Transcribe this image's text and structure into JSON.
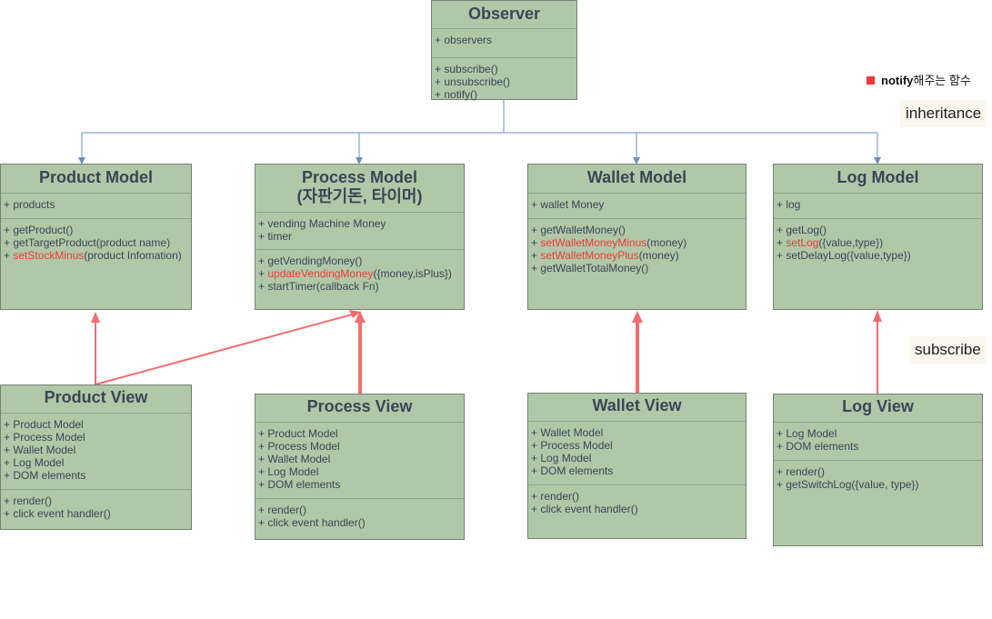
{
  "legend": {
    "bold": "notify",
    "rest": "해주는 함수"
  },
  "tags": {
    "inheritance": "inheritance",
    "subscribe": "subscribe"
  },
  "colors": {
    "box_fill": "#b0c8a8",
    "box_border": "#738272",
    "highlight": "#f0393b",
    "subscribe_arrow": "#f26d6d",
    "inherit_line": "#6c8ebf"
  },
  "observer": {
    "title": "Observer",
    "attrs": [
      "+ observers"
    ],
    "methods": [
      "+ subscribe()",
      "+ unsubscribe()",
      "+ notify()"
    ]
  },
  "product_model": {
    "title": "Product Model",
    "attrs": [
      "+ products"
    ],
    "methods": [
      {
        "pre": "+ ",
        "hl": "",
        "rest": "getProduct()"
      },
      {
        "pre": "+ ",
        "hl": "",
        "rest": "getTargetProduct(product name)"
      },
      {
        "pre": "+ ",
        "hl": "setStockMinus",
        "rest": "(product Infomation)"
      }
    ]
  },
  "process_model": {
    "title_line1": "Process Model",
    "title_line2": "(자판기돈, 타이머)",
    "attrs": [
      "+ vending Machine Money",
      "+ timer"
    ],
    "methods": [
      {
        "pre": "+ ",
        "hl": "",
        "rest": "getVendingMoney()"
      },
      {
        "pre": "+ ",
        "hl": "updateVendingMoney",
        "rest": "({money,isPlus})"
      },
      {
        "pre": "+ ",
        "hl": "",
        "rest": "startTimer(callback Fn)"
      }
    ]
  },
  "wallet_model": {
    "title": "Wallet Model",
    "attrs": [
      "+ wallet Money"
    ],
    "methods": [
      {
        "pre": "+ ",
        "hl": "",
        "rest": "getWalletMoney()"
      },
      {
        "pre": "+ ",
        "hl": "setWalletMoneyMinus",
        "rest": "(money)"
      },
      {
        "pre": "+ ",
        "hl": "setWalletMoneyPlus",
        "rest": "(money)"
      },
      {
        "pre": "+ ",
        "hl": "",
        "rest": "getWalletTotalMoney()"
      }
    ]
  },
  "log_model": {
    "title": "Log Model",
    "attrs": [
      "+ log"
    ],
    "methods": [
      {
        "pre": "+ ",
        "hl": "",
        "rest": "getLog()"
      },
      {
        "pre": "+ ",
        "hl": "setLog",
        "rest": "({value,type})"
      },
      {
        "pre": "+ ",
        "hl": "",
        "rest": "setDelayLog({value,type})"
      }
    ]
  },
  "product_view": {
    "title": "Product View",
    "attrs": [
      "+ Product Model",
      "+ Process Model",
      "+ Wallet Model",
      "+ Log Model",
      "+ DOM elements"
    ],
    "methods": [
      "+ render()",
      "+ click event handler()"
    ]
  },
  "process_view": {
    "title": "Process View",
    "attrs": [
      "+ Product Model",
      "+ Process Model",
      "+ Wallet Model",
      "+ Log Model",
      "+ DOM elements"
    ],
    "methods": [
      "+ render()",
      "+ click event handler()"
    ]
  },
  "wallet_view": {
    "title": "Wallet View",
    "attrs": [
      "+ Wallet Model",
      "+ Process Model",
      "+ Log Model",
      "+ DOM elements"
    ],
    "methods": [
      "+ render()",
      "+ click event handler()"
    ]
  },
  "log_view": {
    "title": "Log View",
    "attrs": [
      "+ Log Model",
      "+ DOM elements"
    ],
    "methods": [
      "+ render()",
      "+ getSwitchLog({value, type})"
    ]
  }
}
